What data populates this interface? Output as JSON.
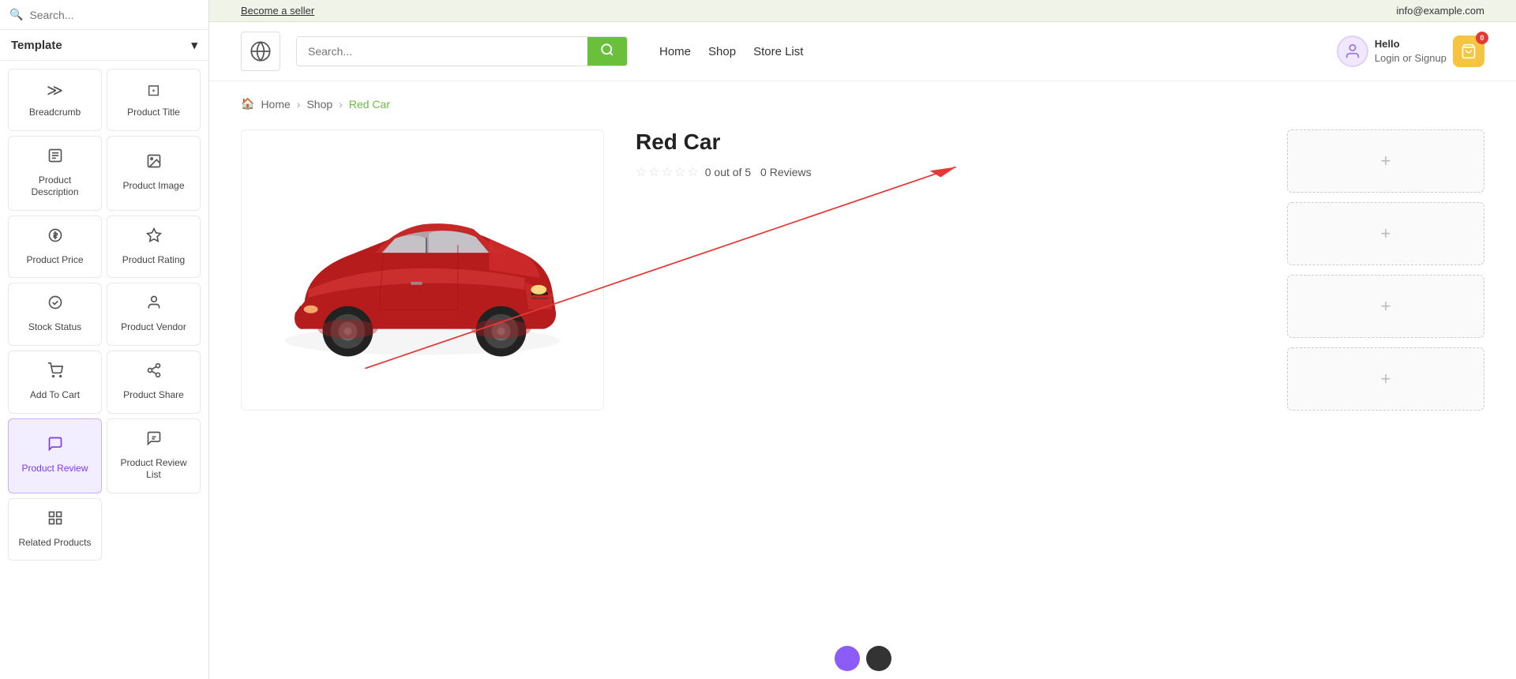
{
  "sidebar": {
    "search_placeholder": "Search...",
    "template_label": "Template",
    "items": [
      {
        "id": "breadcrumb",
        "label": "Breadcrumb",
        "icon": "≫"
      },
      {
        "id": "product-title",
        "label": "Product Title",
        "icon": "⊡"
      },
      {
        "id": "product-description",
        "label": "Product Description",
        "icon": "☰"
      },
      {
        "id": "product-image",
        "label": "Product Image",
        "icon": "🖼"
      },
      {
        "id": "product-price",
        "label": "Product Price",
        "icon": "⊙"
      },
      {
        "id": "product-rating",
        "label": "Product Rating",
        "icon": "☆"
      },
      {
        "id": "stock-status",
        "label": "Stock Status",
        "icon": "⚙"
      },
      {
        "id": "product-vendor",
        "label": "Product Vendor",
        "icon": "👤"
      },
      {
        "id": "add-to-cart",
        "label": "Add To Cart",
        "icon": "🛒"
      },
      {
        "id": "product-share",
        "label": "Product Share",
        "icon": "⎇"
      },
      {
        "id": "product-review",
        "label": "Product Review",
        "icon": "💬",
        "active": true
      },
      {
        "id": "product-review-list",
        "label": "Product Review List",
        "icon": "🗨"
      },
      {
        "id": "related-products",
        "label": "Related Products",
        "icon": "⊞"
      }
    ]
  },
  "topbar": {
    "become_seller": "Become a seller",
    "email": "info@example.com"
  },
  "navbar": {
    "logo_icon": "🌐",
    "search_placeholder": "Search...",
    "search_btn_icon": "🔍",
    "nav_links": [
      "Home",
      "Shop",
      "Store List"
    ],
    "user_greeting": "Hello",
    "user_action": "Login or Signup",
    "cart_count": "0"
  },
  "breadcrumb": {
    "home": "Home",
    "shop": "Shop",
    "current": "Red Car"
  },
  "product": {
    "title": "Red Car",
    "rating_value": "0",
    "rating_max": "5",
    "review_count": "0",
    "reviews_label": "Reviews"
  },
  "placeholders": {
    "plus": "+"
  }
}
